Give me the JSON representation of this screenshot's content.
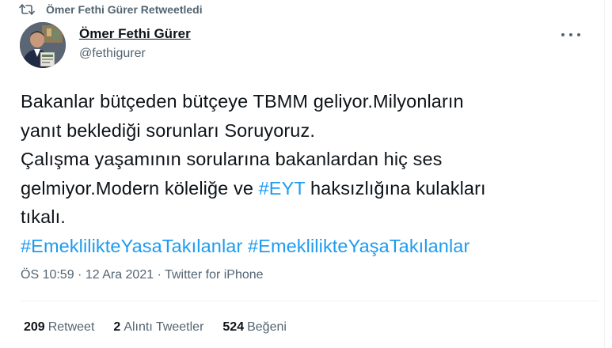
{
  "retweet_header": {
    "text": "Ömer Fethi Gürer Retweetledi",
    "icon": "retweet-icon"
  },
  "author": {
    "name": "Ömer Fethi Gürer",
    "handle": "@fethigurer",
    "avatar": "profile-photo"
  },
  "menu_icon": "more-horizontal-icon",
  "tweet": {
    "line1": "Bakanlar bütçeden bütçeye TBMM geliyor.Milyonların",
    "line2": "yanıt beklediği sorunları Soruyoruz.",
    "line3": "Çalışma yaşamının sorularına bakanlardan hiç ses",
    "line4_pre": "gelmiyor.Modern köleliğe ve ",
    "line4_hashtag": "#EYT",
    "line4_post": " haksızlığına kulakları",
    "line5": "tıkalı.",
    "hashtag1": "#EmeklilikteYasaTakılanlar",
    "hashtag2": "#EmeklilikteYaşaTakılanlar"
  },
  "meta": {
    "time": "ÖS 10:59",
    "sep1": " · ",
    "date": "12 Ara 2021",
    "sep2": " · ",
    "source": "Twitter for iPhone"
  },
  "stats": {
    "retweets_count": "209",
    "retweets_label": "Retweet",
    "quotes_count": "2",
    "quotes_label": "Alıntı Tweetler",
    "likes_count": "524",
    "likes_label": "Beğeni"
  },
  "colors": {
    "link": "#1d9bf0",
    "text": "#0f1419",
    "secondary": "#536471"
  }
}
